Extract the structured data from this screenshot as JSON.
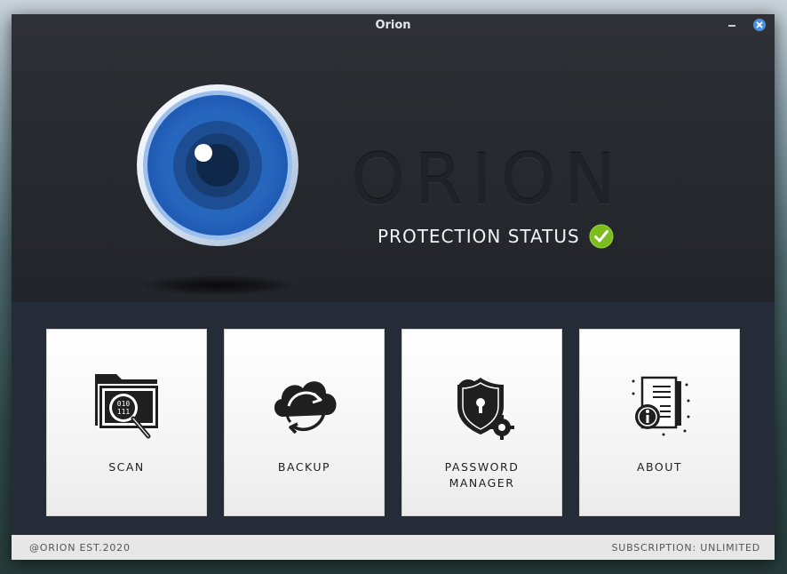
{
  "window": {
    "title": "Orion",
    "controls": [
      "minimize-icon",
      "close-icon"
    ]
  },
  "hero": {
    "brand": "ORION",
    "status_label": "PROTECTION STATUS",
    "status_icon": "check-circle-icon",
    "status_color": "#7cbd1e",
    "logo": "eye-lens-logo"
  },
  "tiles": [
    {
      "label": "SCAN",
      "icon": "folder-scan-icon"
    },
    {
      "label": "BACKUP",
      "icon": "cloud-sync-icon"
    },
    {
      "label": "PASSWORD\nMANAGER",
      "icon": "shield-lock-icon"
    },
    {
      "label": "ABOUT",
      "icon": "document-info-icon"
    }
  ],
  "footer": {
    "left": "@ORION EST.2020",
    "right": "SUBSCRIPTION: UNLIMITED"
  },
  "colors": {
    "accent": "#2c6fc5",
    "close_button": "#4a90e2",
    "tile_panel_bg": "#252c38"
  }
}
